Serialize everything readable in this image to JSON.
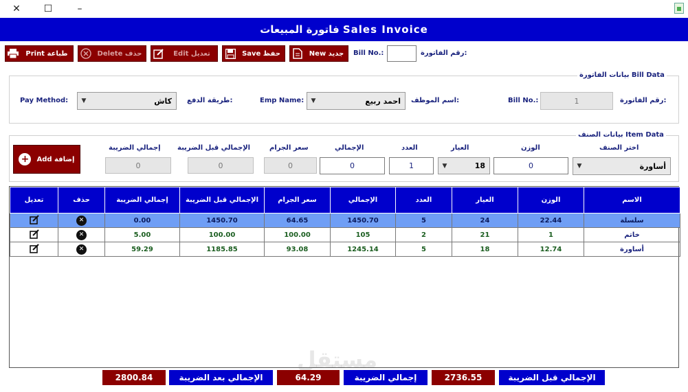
{
  "window": {
    "minimize": "–",
    "maximize": "☐",
    "close": "✕"
  },
  "banner": {
    "title": "فاتورة المبيعات  Sales Invoice"
  },
  "toolbar": {
    "print_label": "Print  طباعة",
    "delete_label": "Delete  حذف",
    "edit_label": "Edit  تعديل",
    "save_label": "Save  حفظ",
    "new_label": "New  جديد",
    "bill_no_en": "Bill No.:",
    "bill_no_ar": "رقم الفاتورة:",
    "bill_no_value": ""
  },
  "bill_data": {
    "group_title": "بيانات الفاتورة  Bill Data",
    "pay_method_en": "Pay Method:",
    "pay_method_ar": "طريقة الدفع:",
    "pay_method_value": "كاش",
    "emp_name_en": "Emp Name:",
    "emp_name_ar": "اسم الموظف:",
    "emp_name_value": "احمد ربيع",
    "bill_no_en": "Bill No.:",
    "bill_no_ar": "رقم الفاتورة:",
    "bill_no_value": "1"
  },
  "item_data": {
    "group_title": "بيانات الصنف  Item Data",
    "add_label": "Add  إضافة",
    "labels": {
      "tax_total": "إجمالي الضريبة",
      "pre_tax_total": "الإجمالي قبل الضريبة",
      "gram_price": "سعر الجرام",
      "total": "الإجمالي",
      "count": "العدد",
      "karat": "العيار",
      "weight": "الوزن",
      "choose_item": "اختر الصنف"
    },
    "values": {
      "tax_total": "0",
      "pre_tax_total": "0",
      "gram_price": "0",
      "total": "0",
      "count": "1",
      "karat": "18",
      "weight": "0",
      "choose_item": "أساورة"
    }
  },
  "table": {
    "headers": {
      "edit": "تعديل",
      "delete": "حذف",
      "tax_total": "إجمالي الضريبة",
      "pre_tax_total": "الإجمالي قبل الضريبة",
      "gram_price": "سعر الجرام",
      "total": "الإجمالي",
      "count": "العدد",
      "karat": "العيار",
      "weight": "الوزن",
      "name": "الاسم"
    },
    "rows": [
      {
        "tax": "0.00",
        "pre_tax": "1450.70",
        "gram_price": "64.65",
        "total": "1450.70",
        "count": "5",
        "karat": "24",
        "weight": "22.44",
        "name": "سلسلة"
      },
      {
        "tax": "5.00",
        "pre_tax": "100.00",
        "gram_price": "100.00",
        "total": "105",
        "count": "2",
        "karat": "21",
        "weight": "1",
        "name": "خاتم"
      },
      {
        "tax": "59.29",
        "pre_tax": "1185.85",
        "gram_price": "93.08",
        "total": "1245.14",
        "count": "5",
        "karat": "18",
        "weight": "12.74",
        "name": "أساورة"
      }
    ]
  },
  "footer": {
    "grand_total_value": "2800.84",
    "grand_total_label": "الإجمالي بعد الضريبة",
    "tax_value": "64.29",
    "tax_label": "إجمالي الضريبة",
    "pre_tax_value": "2736.55",
    "pre_tax_label": "الإجمالي قبل الضريبة"
  },
  "watermark": "مستقل",
  "colors": {
    "accent_blue": "#0000cc",
    "button_red": "#8b0000",
    "selected_row": "#6f9ef5"
  }
}
